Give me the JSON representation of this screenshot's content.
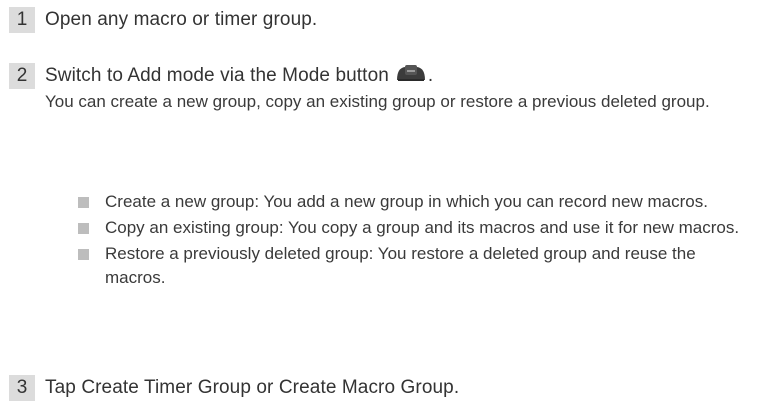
{
  "steps": [
    {
      "number": "1",
      "text": "Open any macro or timer group."
    },
    {
      "number": "2",
      "text": "Switch to Add mode via the Mode button",
      "text_after_icon": ".",
      "icon": "mode-button-icon",
      "description": "You can create a new group, copy an existing group or restore a previous deleted group."
    },
    {
      "number": "3",
      "text": "Tap Create Timer Group or Create Macro Group."
    }
  ],
  "bullets": [
    "Create a new group: You add a new group in which you can record new macros.",
    "Copy an existing group: You copy a group and its macros and use it for new macros.",
    "Restore a previously deleted group: You restore a deleted group and reuse the macros."
  ],
  "colors": {
    "number_badge": "#dcdcdc",
    "bullet_square": "#bdbdbd",
    "text": "#333333"
  }
}
